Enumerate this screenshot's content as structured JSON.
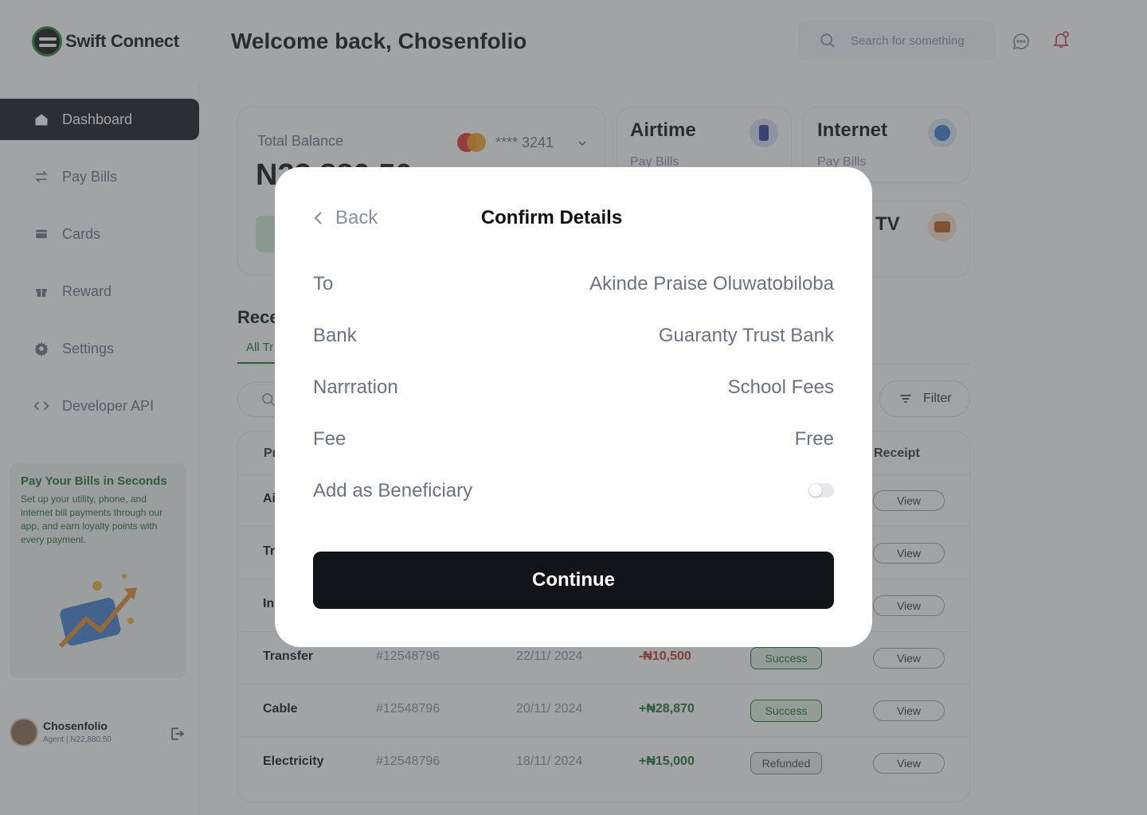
{
  "app": {
    "name": "Swift Connect",
    "welcome": "Welcome back, Chosenfolio",
    "search_placeholder": "Search for something"
  },
  "sidebar": {
    "items": [
      {
        "label": "Dashboard",
        "icon": "home-icon"
      },
      {
        "label": "Pay Bills",
        "icon": "transfer-arrows-icon"
      },
      {
        "label": "Cards",
        "icon": "card-icon"
      },
      {
        "label": "Reward",
        "icon": "gift-icon"
      },
      {
        "label": "Settings",
        "icon": "gear-icon"
      },
      {
        "label": "Developer API",
        "icon": "code-icon"
      }
    ],
    "promo": {
      "title": "Pay Your Bills in Seconds",
      "text": "Set up your utility, phone, and internet bill payments through our app, and earn loyalty points with every payment."
    },
    "profile": {
      "name": "Chosenfolio",
      "subtitle": "Agent | N22,880.50"
    }
  },
  "balance": {
    "title": "Total Balance",
    "card_mask": "**** 3241",
    "amount_partial": "N22,880.50"
  },
  "services": [
    {
      "title": "Airtime",
      "sub": "Pay Bills"
    },
    {
      "title": "Internet",
      "sub": "Pay Bills"
    },
    {
      "title": "TV",
      "sub": ""
    }
  ],
  "recent": {
    "heading_partial": "Rece",
    "tab_partial": "All Tr",
    "filter": "Filter",
    "header_partial": "Pr",
    "header_receipt": "Receipt",
    "rows": [
      {
        "name": "Ai",
        "id": "",
        "date": "",
        "amount": "",
        "status": "",
        "view": "View"
      },
      {
        "name": "Tr",
        "id": "",
        "date": "",
        "amount": "",
        "status": "",
        "view": "View"
      },
      {
        "name": "In",
        "id": "",
        "date": "",
        "amount": "",
        "status": "",
        "view": "View"
      },
      {
        "name": "Transfer",
        "id": "#12548796",
        "date": "22/11/ 2024",
        "amount": "-₦10,500",
        "status": "Success",
        "view": "View"
      },
      {
        "name": "Cable",
        "id": "#12548796",
        "date": "20/11/ 2024",
        "amount": "+₦28,870",
        "status": "Success",
        "view": "View"
      },
      {
        "name": "Electricity",
        "id": "#12548796",
        "date": "18/11/ 2024",
        "amount": "+₦15,000",
        "status": "Refunded",
        "view": "View"
      }
    ]
  },
  "modal": {
    "back": "Back",
    "title": "Confirm Details",
    "fields": [
      {
        "label": "To",
        "value": "Akinde Praise Oluwatobiloba"
      },
      {
        "label": "Bank",
        "value": "Guaranty Trust Bank"
      },
      {
        "label": "Narrration",
        "value": "School Fees"
      },
      {
        "label": "Fee",
        "value": "Free"
      }
    ],
    "beneficiary_label": "Add as Beneficiary",
    "beneficiary_on": false,
    "continue": "Continue"
  },
  "colors": {
    "primary": "#11151a",
    "success": "#1c6b34",
    "negative": "#c0392b"
  }
}
